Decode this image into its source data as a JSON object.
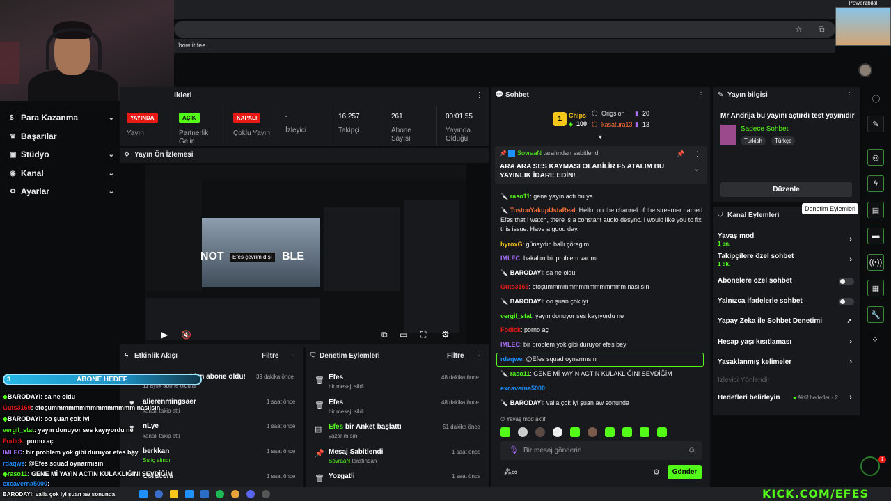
{
  "browser": {
    "bookmark_1": "'how it fee...",
    "pip_name": "Powerzbilal"
  },
  "leftnav": {
    "items": [
      {
        "label": "Para Kazanma",
        "icon": "dollar-icon",
        "has_chevron": true
      },
      {
        "label": "Başarılar",
        "icon": "trophy-icon",
        "has_chevron": false
      },
      {
        "label": "Stüdyo",
        "icon": "studio-icon",
        "has_chevron": true
      },
      {
        "label": "Kanal",
        "icon": "channel-icon",
        "has_chevron": true
      },
      {
        "label": "Ayarlar",
        "icon": "gear-icon",
        "has_chevron": true
      }
    ]
  },
  "stats": {
    "title": "ikleri",
    "cells": [
      {
        "value": "YAYINDA",
        "label": "Yayın",
        "badge_color": "#e91916"
      },
      {
        "value": "AÇIK",
        "label": "Partnerlik Gelir",
        "badge_color": "#53fc18"
      },
      {
        "value": "KAPALI",
        "label": "Çoklu Yayın",
        "badge_color": "#e91916"
      },
      {
        "value": "-",
        "label": "İzleyici"
      },
      {
        "value": "16.257",
        "label": "Takipçi"
      },
      {
        "value": "261",
        "label": "Abone Sayısı"
      },
      {
        "value": "00:01:55",
        "label": "Yayında Olduğu"
      }
    ]
  },
  "preview": {
    "title": "Yayın Ön İzlemesi",
    "overlay_text_1": "NOT",
    "overlay_text_2": "BLE",
    "offline_tag": "Efes çevrim dışı"
  },
  "activity": {
    "title": "Etkinlik Akışı",
    "filter": "Filtre",
    "rows": [
      {
        "title": "Emravage yeniden abone oldu!",
        "sub": "11 aylık abone oldular",
        "time": "39 dakika önce"
      },
      {
        "title": "alierenmingsaer",
        "sub": "kanalı takip etti",
        "time": "1 saat önce"
      },
      {
        "title": "nLye",
        "sub": "kanalı takip etti",
        "time": "1 saat önce"
      },
      {
        "title": "berkkan",
        "sub": "Su iç alındı",
        "time": "1 saat önce"
      },
      {
        "title": "Corticera",
        "sub": "",
        "time": "1 saat önce"
      }
    ]
  },
  "modactions": {
    "title": "Denetim Eylemleri",
    "filter": "Filtre",
    "rows": [
      {
        "title": "Efes",
        "sub": "bir mesajı sildi",
        "time": "48 dakika önce"
      },
      {
        "title": "Efes",
        "sub": "bir mesajı sildi",
        "time": "48 dakika önce"
      },
      {
        "title_user": "Efes",
        "title_rest": " bir Anket başlattı",
        "sub": "yazar mısın",
        "time": "51 dakika önce"
      },
      {
        "title": "Mesaj Sabitlendi",
        "sub_user": "SovraaN",
        "sub_rest": " tarafından",
        "time": "1 saat önce"
      },
      {
        "title": "Yozgatli",
        "sub": "",
        "time": "1 saat önce"
      }
    ]
  },
  "chat": {
    "title": "Sohbet",
    "top": {
      "rank": "1",
      "chips_label": "Chips",
      "chips_count": "100",
      "user1": "Origsion",
      "user1_count": "20",
      "user2": "kasatura13",
      "user2_count": "13"
    },
    "pinned": {
      "by_user": "SovraaN",
      "by_rest": "tarafından sabitlendi",
      "text": "ARA ARA SES KAYMASI OLABİLİR F5 ATALIM BU YAYINLIK İDARE EDİN!"
    },
    "messages": [
      {
        "user": "raso11",
        "color": "#53fc18",
        "text": ": gene yayın actı bu ya"
      },
      {
        "user": "TostcuYakupUstaReal",
        "color": "#ff6e3a",
        "text": ": Hello, on the channel of the streamer named Efes that I watch, there is a constant audio desync. I would like you to fix this issue. Have a good day."
      },
      {
        "user": "hyroxG",
        "color": "#f5c518",
        "text": ": günaydın ballı çöregim"
      },
      {
        "user": "IMLEC",
        "color": "#a970ff",
        "text": ": bakalım bir problem var mı"
      },
      {
        "user": "BARODAYI",
        "color": "#ffffff",
        "text": ": sa ne oldu"
      },
      {
        "user": "Guts3169",
        "color": "#e91916",
        "text": ": efoşummmmmmmmmmmmmmm nasılsın"
      },
      {
        "user": "BARODAYI",
        "color": "#ffffff",
        "text": ": oo şuan çok iyi"
      },
      {
        "user": "vergil_stat",
        "color": "#53fc18",
        "text": ": yayın donuyor ses kayıyordu ne"
      },
      {
        "user": "Fodick",
        "color": "#e91916",
        "text": ": porno aç"
      },
      {
        "user": "IMLEC",
        "color": "#a970ff",
        "text": ": bir problem yok gibi duruyor efes bey"
      },
      {
        "user": "rdaqwe",
        "color": "#1e90ff",
        "text": ": @Efes squad oynarmısın"
      },
      {
        "user": "raso11",
        "color": "#53fc18",
        "text": ": GENE Mİ YAYIN ACTIN KULAKLIĞINI SEVDİĞİM"
      },
      {
        "user": "excaverna5000",
        "color": "#1e90ff",
        "text": ":"
      },
      {
        "user": "BARODAYI",
        "color": "#ffffff",
        "text": ": valla çok iyi şuan aw sonunda"
      }
    ],
    "slow_mode": "Yavaş mod aktif",
    "input_placeholder": "Bir mesaj gönderin",
    "send": "Gönder"
  },
  "streaminfo": {
    "title": "Yayın bilgisi",
    "stream_title": "Mr Andrija bu yayını açtırdı test yayınıdır",
    "category": "Sadece Sohbet",
    "tags": [
      "Turkish",
      "Türkçe"
    ],
    "edit": "Düzenle",
    "tooltip": "Denetim Eylemleri"
  },
  "chanactions": {
    "title": "Kanal Eylemleri",
    "rows": [
      {
        "label": "Yavaş mod",
        "sub": "1 sn.",
        "control": "chevron"
      },
      {
        "label": "Takipçilere özel sohbet",
        "sub": "1 dk.",
        "control": "chevron"
      },
      {
        "label": "Abonelere özel sohbet",
        "sub": "",
        "control": "toggle"
      },
      {
        "label": "Yalnızca ifadelerle sohbet",
        "sub": "",
        "control": "toggle"
      },
      {
        "label": "Yapay Zeka ile Sohbet Denetimi",
        "sub": "",
        "control": "external"
      },
      {
        "label": "Hesap yaşı kısıtlaması",
        "sub": "",
        "control": "chevron"
      },
      {
        "label": "Yasaklanmış kelimeler",
        "sub": "",
        "control": "chevron"
      },
      {
        "label": "İzleyici Yönlendir",
        "sub": "",
        "control": "none"
      },
      {
        "label": "Hedefleri belirleyin",
        "sub": "",
        "control": "goals",
        "extra": "Aktif hedefler - 2"
      }
    ]
  },
  "overlay": {
    "goal_left": "3",
    "goal_label": "ABONE HEDEF",
    "lines": [
      {
        "user": "BARODAYI",
        "text": ": sa ne oldu",
        "color": "#ffffff"
      },
      {
        "user": "Guts3169",
        "text": ": efoşummmmmmmmmmmmmmm nasılsın",
        "color": "#e91916"
      },
      {
        "user": "BARODAYI",
        "text": ": oo şuan çok iyi",
        "color": "#ffffff"
      },
      {
        "user": "vergil_stat",
        "text": ": yayın donuyor ses kayıyordu ne",
        "color": "#53fc18"
      },
      {
        "user": "Fodick",
        "text": ": porno aç",
        "color": "#e91916"
      },
      {
        "user": "IMLEC",
        "text": ": bir problem yok gibi duruyor efes bey",
        "color": "#a970ff"
      },
      {
        "user": "rdaqwe",
        "text": ": @Efes squad oynarmısın",
        "color": "#1e90ff"
      },
      {
        "user": "raso11",
        "text": ": GENE Mİ YAYIN ACTIN KULAKLIĞINI SEVDİĞİM",
        "color": "#53fc18"
      },
      {
        "user": "excaverna5000",
        "text": ":",
        "color": "#1e90ff"
      },
      {
        "user": "BARODAYI",
        "text": ": valla çok iyi şuan aw sonunda",
        "color": "#ffffff"
      }
    ],
    "kick": "KICK.COM/EFES",
    "notif_count": "1"
  },
  "colors": {
    "accent": "#53fc18",
    "panel": "#18191c",
    "bg": "#0b0c0e"
  }
}
